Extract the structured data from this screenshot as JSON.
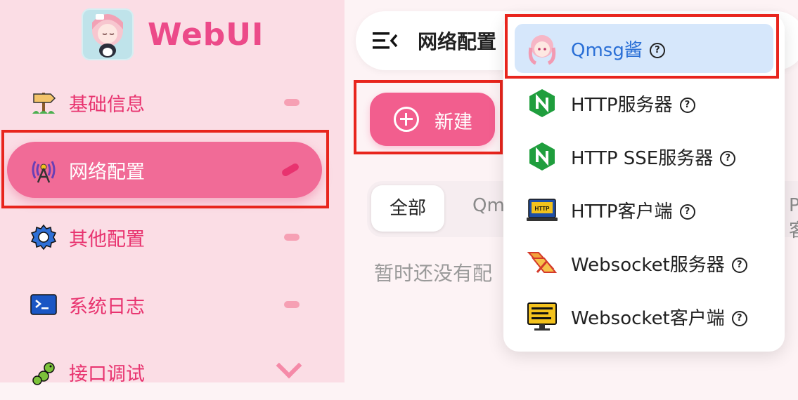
{
  "brand": {
    "title": "WebUI"
  },
  "sidebar": {
    "items": [
      {
        "label": "基础信息",
        "icon": "signpost-icon"
      },
      {
        "label": "网络配置",
        "icon": "antenna-icon",
        "active": true
      },
      {
        "label": "其他配置",
        "icon": "gear-icon"
      },
      {
        "label": "系统日志",
        "icon": "terminal-icon"
      },
      {
        "label": "接口调试",
        "icon": "bug-icon",
        "expandable": true
      }
    ]
  },
  "header": {
    "title": "网络配置",
    "menu_icon": "collapse-menu-icon"
  },
  "main": {
    "new_button_label": "新建",
    "tabs": [
      {
        "label": "全部"
      },
      {
        "label": "Qm"
      },
      {
        "label": "P客"
      }
    ],
    "empty_text": "暂时还没有配"
  },
  "dropdown": {
    "items": [
      {
        "label": "Qmsg酱",
        "help": "?",
        "icon": "qmsg-avatar-icon",
        "selected": true
      },
      {
        "label": "HTTP服务器",
        "help": "?",
        "icon": "nginx-icon"
      },
      {
        "label": "HTTP SSE服务器",
        "help": "?",
        "icon": "nginx-icon"
      },
      {
        "label": "HTTP客户端",
        "help": "?",
        "icon": "http-laptop-icon"
      },
      {
        "label": "Websocket服务器",
        "help": "?",
        "icon": "websocket-icon"
      },
      {
        "label": "Websocket客户端",
        "help": "?",
        "icon": "monitor-icon"
      }
    ]
  },
  "colors": {
    "accent": "#f25e8e",
    "sidebar_bg": "#fbdde5",
    "highlight_box": "#e8251d",
    "selected_bg": "#d6e7fb"
  }
}
